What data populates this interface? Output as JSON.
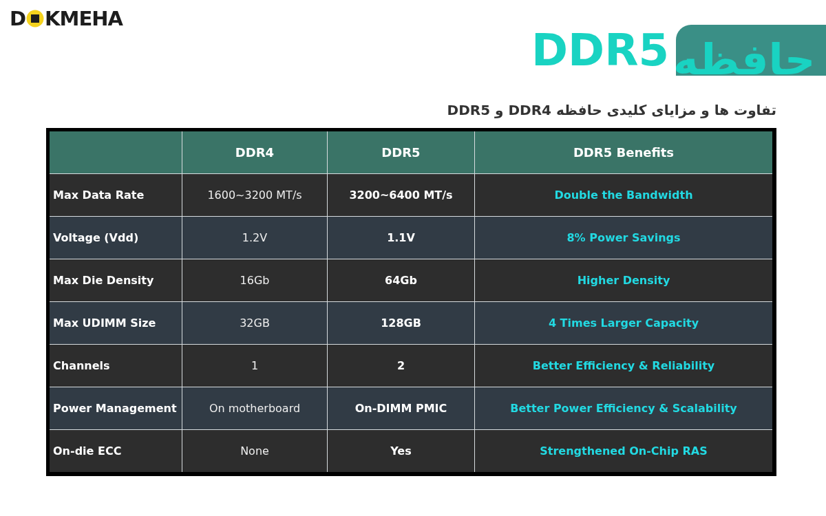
{
  "logo": {
    "before": "D",
    "after": "KMEHA"
  },
  "title": {
    "latin": "DDR5",
    "persian": "حافظه"
  },
  "subtitle": "تفاوت ها و مزایای کلیدی حافظه DDR4 و DDR5",
  "table": {
    "columns": [
      "DDR4",
      "DDR5",
      "DDR5 Benefits"
    ],
    "rows": [
      {
        "feature": "Max Data Rate",
        "ddr4": "1600~3200 MT/s",
        "ddr5": "3200~6400 MT/s",
        "benefit": "Double the Bandwidth"
      },
      {
        "feature": "Voltage (Vdd)",
        "ddr4": "1.2V",
        "ddr5": "1.1V",
        "benefit": "8% Power Savings"
      },
      {
        "feature": "Max Die Density",
        "ddr4": "16Gb",
        "ddr5": "64Gb",
        "benefit": "Higher Density"
      },
      {
        "feature": "Max UDIMM Size",
        "ddr4": "32GB",
        "ddr5": "128GB",
        "benefit": "4 Times Larger Capacity"
      },
      {
        "feature": "Channels",
        "ddr4": "1",
        "ddr5": "2",
        "benefit": "Better Efficiency & Reliability"
      },
      {
        "feature": "Power Management",
        "ddr4": "On motherboard",
        "ddr5": "On-DIMM PMIC",
        "benefit": "Better Power Efficiency & Scalability"
      },
      {
        "feature": "On-die ECC",
        "ddr4": "None",
        "ddr5": "Yes",
        "benefit": "Strengthened On-Chip RAS"
      }
    ]
  }
}
